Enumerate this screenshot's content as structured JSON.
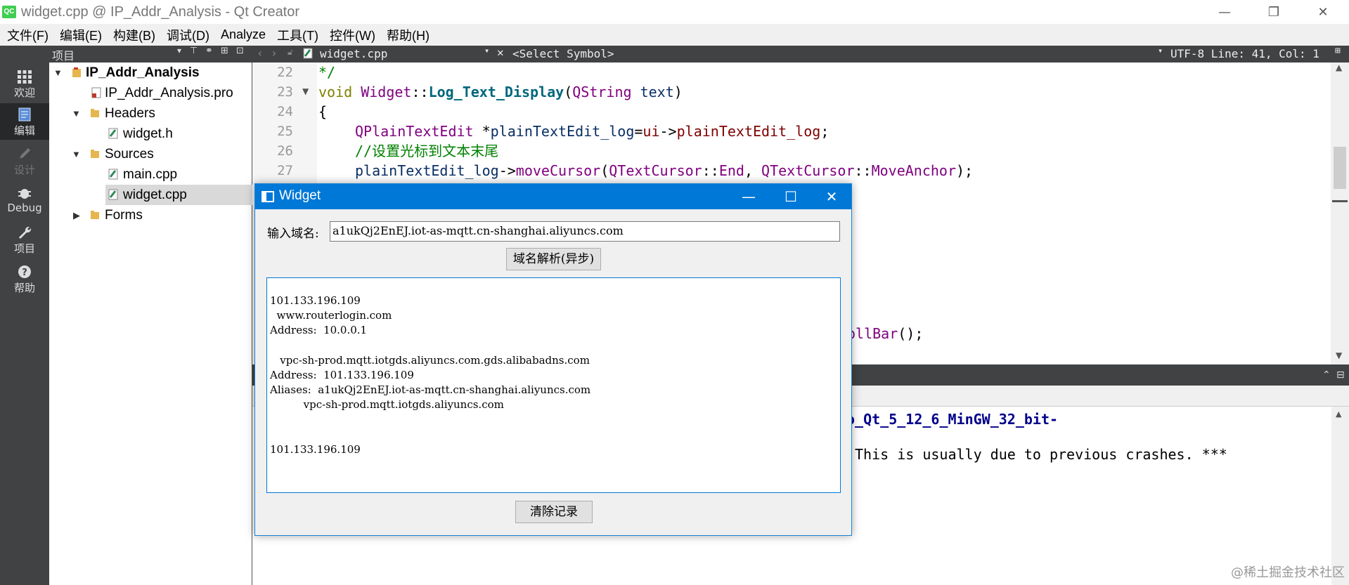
{
  "window": {
    "app_badge": "QC",
    "title": "widget.cpp @ IP_Addr_Analysis - Qt Creator",
    "minimize": "—",
    "restore": "❐",
    "close": "✕"
  },
  "menu": [
    "文件(F)",
    "编辑(E)",
    "构建(B)",
    "调试(D)",
    "Analyze",
    "工具(T)",
    "控件(W)",
    "帮助(H)"
  ],
  "modes": [
    {
      "label": "欢迎",
      "icon": "grid-icon"
    },
    {
      "label": "编辑",
      "icon": "edit-document-icon"
    },
    {
      "label": "设计",
      "icon": "pencil-icon"
    },
    {
      "label": "Debug",
      "icon": "bug-icon"
    },
    {
      "label": "项目",
      "icon": "wrench-icon"
    },
    {
      "label": "帮助",
      "icon": "help-circle-icon"
    }
  ],
  "project_panel": {
    "header": "项目",
    "tree": [
      {
        "label": "IP_Addr_Analysis",
        "bold": true
      },
      {
        "label": "IP_Addr_Analysis.pro"
      },
      {
        "label": "Headers"
      },
      {
        "label": "widget.h"
      },
      {
        "label": "Sources"
      },
      {
        "label": "main.cpp"
      },
      {
        "label": "widget.cpp",
        "selected": true
      },
      {
        "label": "Forms"
      }
    ]
  },
  "editor": {
    "file": "widget.cpp",
    "symbol": "<Select Symbol>",
    "status": "UTF-8 Line: 41, Col: 1",
    "line_numbers": [
      "22",
      "23",
      "24",
      "25",
      "26",
      "27"
    ],
    "code": {
      "l22": "*/",
      "l23_kw": "void",
      "l23_cls": "Widget",
      "l23_sep": "::",
      "l23_fn": "Log_Text_Display",
      "l23_paren": "(",
      "l23_type": "QString",
      "l23_arg": " text",
      "l23_close": ")",
      "l24": "{",
      "l25_type": "QPlainTextEdit",
      "l25_star": " *",
      "l25_var": "plainTextEdit_log",
      "l25_eq": "=",
      "l25_ui": "ui",
      "l25_arrow": "->",
      "l25_mem": "plainTextEdit_log",
      "l25_end": ";",
      "l26": "//设置光标到文本末尾",
      "l27_var": "plainTextEdit_log",
      "l27_arrow": "->",
      "l27_fn": "moveCursor",
      "l27_p1": "(",
      "l27_t1": "QTextCursor",
      "l27_s1": "::",
      "l27_e1": "End",
      "l27_c": ", ",
      "l27_t2": "QTextCursor",
      "l27_s2": "::",
      "l27_e2": "MoveAnchor",
      "l27_end": ");",
      "partial_fn": "ollBar",
      "partial_end": "();"
    }
  },
  "output": {
    "line1": "o_Qt_5_12_6_MinGW_32_bit-",
    "line2": "This is usually due to previous crashes. ***"
  },
  "dialog": {
    "title": "Widget",
    "minimize": "—",
    "maximize": "☐",
    "close": "✕",
    "domain_label": "输入域名:",
    "domain_value": "a1ukQj2EnEJ.iot-as-mqtt.cn-shanghai.aliyuncs.com",
    "resolve_button": "域名解析(异步)",
    "log_lines": [
      "101.133.196.109",
      "  www.routerlogin.com",
      "Address:  10.0.0.1",
      "",
      "   vpc-sh-prod.mqtt.iotgds.aliyuncs.com.gds.alibabadns.com",
      "Address:  101.133.196.109",
      "Aliases:  a1ukQj2EnEJ.iot-as-mqtt.cn-shanghai.aliyuncs.com",
      "          vpc-sh-prod.mqtt.iotgds.aliyuncs.com",
      "",
      "",
      "101.133.196.109"
    ],
    "clear_button": "清除记录"
  },
  "watermark": "@稀土掘金技术社区"
}
